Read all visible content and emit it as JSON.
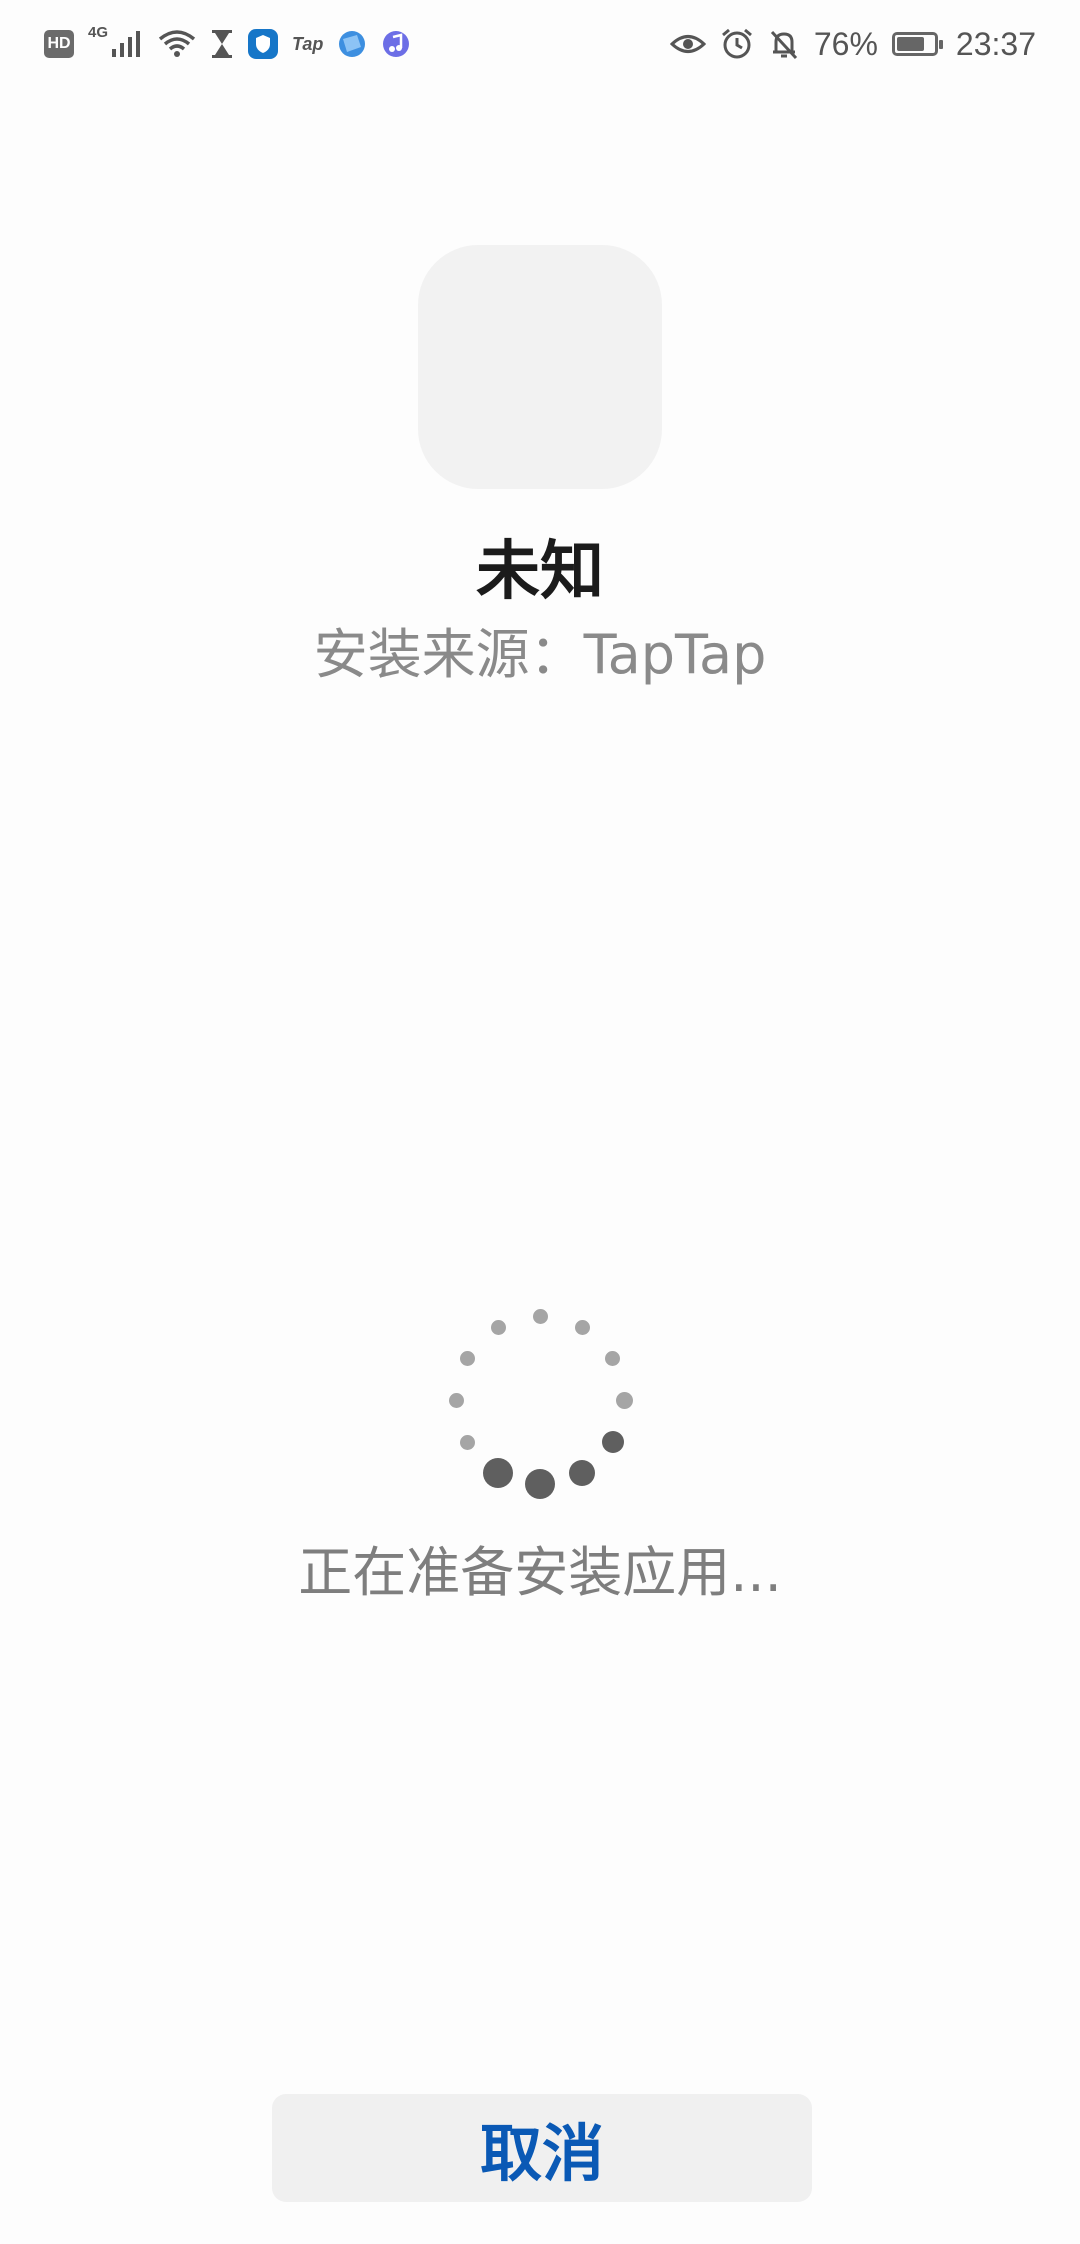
{
  "status_bar": {
    "left_icons": [
      "hd-icon",
      "4g-signal-icon",
      "wifi-icon",
      "hourglass-icon",
      "shield-app-icon",
      "taptap-app-icon",
      "browser-app-icon",
      "music-app-icon"
    ],
    "hd_label": "HD",
    "network_label": "4G",
    "tap_label": "Tap",
    "right_icons": [
      "eye-icon",
      "alarm-icon",
      "bell-off-icon",
      "battery-icon"
    ],
    "battery_percent": "76%",
    "battery_level": 0.76,
    "time": "23:37"
  },
  "app": {
    "name": "未知",
    "install_source": "安装来源：TapTap"
  },
  "progress": {
    "status_text": "正在准备安装应用..."
  },
  "actions": {
    "cancel_label": "取消"
  },
  "colors": {
    "accent": "#0a59b5",
    "icon_placeholder": "#f2f2f2",
    "button_bg": "#f0f0f0",
    "spinner_light": "#a5a5a5",
    "spinner_dark": "#5f5f5f"
  }
}
